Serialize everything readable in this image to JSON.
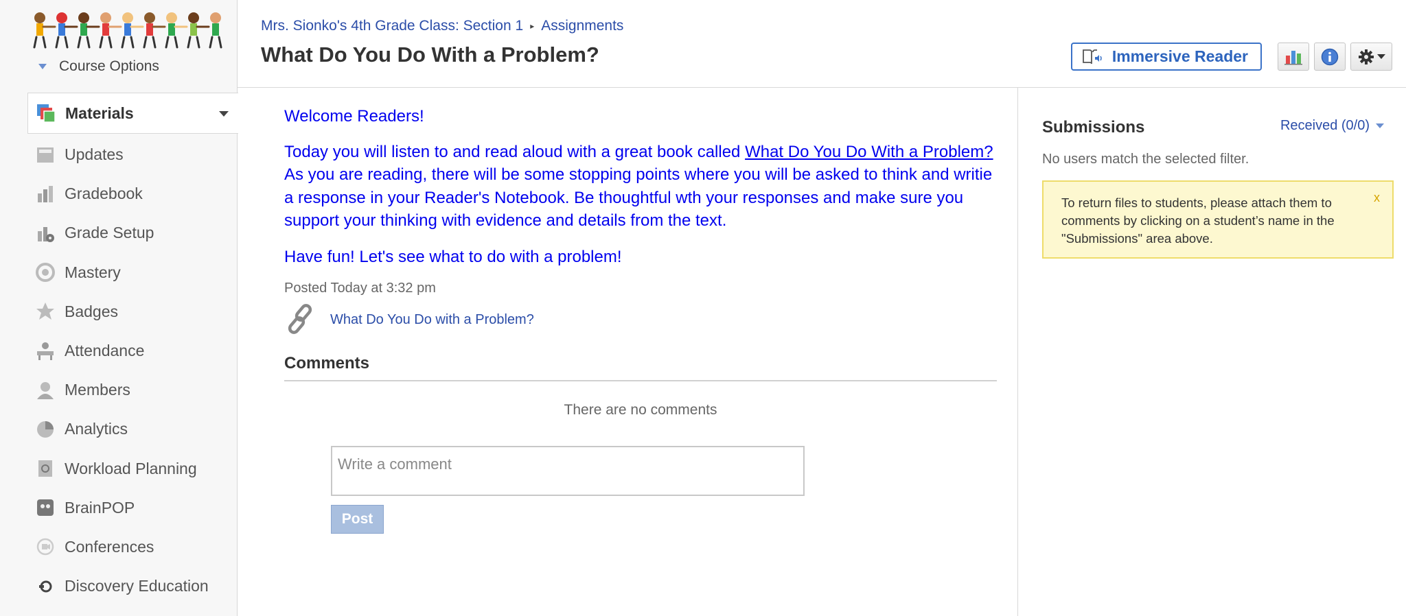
{
  "sidebar": {
    "course_options": "Course Options",
    "items": [
      {
        "label": "Materials",
        "icon": "materials-icon"
      },
      {
        "label": "Updates",
        "icon": "updates-icon"
      },
      {
        "label": "Gradebook",
        "icon": "gradebook-icon"
      },
      {
        "label": "Grade Setup",
        "icon": "grade-setup-icon"
      },
      {
        "label": "Mastery",
        "icon": "mastery-icon"
      },
      {
        "label": "Badges",
        "icon": "badges-icon"
      },
      {
        "label": "Attendance",
        "icon": "attendance-icon"
      },
      {
        "label": "Members",
        "icon": "members-icon"
      },
      {
        "label": "Analytics",
        "icon": "analytics-icon"
      },
      {
        "label": "Workload Planning",
        "icon": "workload-icon"
      },
      {
        "label": "BrainPOP",
        "icon": "brainpop-icon"
      },
      {
        "label": "Conferences",
        "icon": "conferences-icon"
      },
      {
        "label": "Discovery Education",
        "icon": "discovery-icon"
      }
    ]
  },
  "header": {
    "breadcrumb_course": "Mrs. Sionko's 4th Grade Class: Section 1",
    "breadcrumb_separator": "▸",
    "breadcrumb_section": "Assignments",
    "title": "What Do You Do With a Problem?",
    "immersive_reader": "Immersive Reader"
  },
  "main": {
    "welcome": "Welcome Readers!",
    "para_before": "Today you will listen to and read aloud with a great book called ",
    "para_link": "What Do You Do With a Problem?",
    "para_after": " As you are reading, there will be some stopping points where you will be asked to think and writie a response in your Reader's Notebook. Be thoughtful wth your responses and make sure you support your thinking with evidence and details from the text.",
    "have_fun": "Have fun! Let's see what to do with a problem!",
    "posted": "Posted Today at 3:32 pm",
    "attachment": "What Do You Do with a Problem?",
    "comments_heading": "Comments",
    "no_comments": "There are no comments",
    "comment_placeholder": "Write a comment",
    "post_button": "Post"
  },
  "submissions": {
    "title": "Submissions",
    "filter": "Received (0/0)",
    "no_users": "No users match the selected filter.",
    "notice": "To return files to students, please attach them to comments by clicking on a student’s name in the \"Submissions\" area above.",
    "notice_close": "x"
  },
  "colors": {
    "link": "#2b4da8",
    "body_text": "#0000ee",
    "accent": "#3a72c8",
    "notice_bg": "#fdf8d0"
  }
}
